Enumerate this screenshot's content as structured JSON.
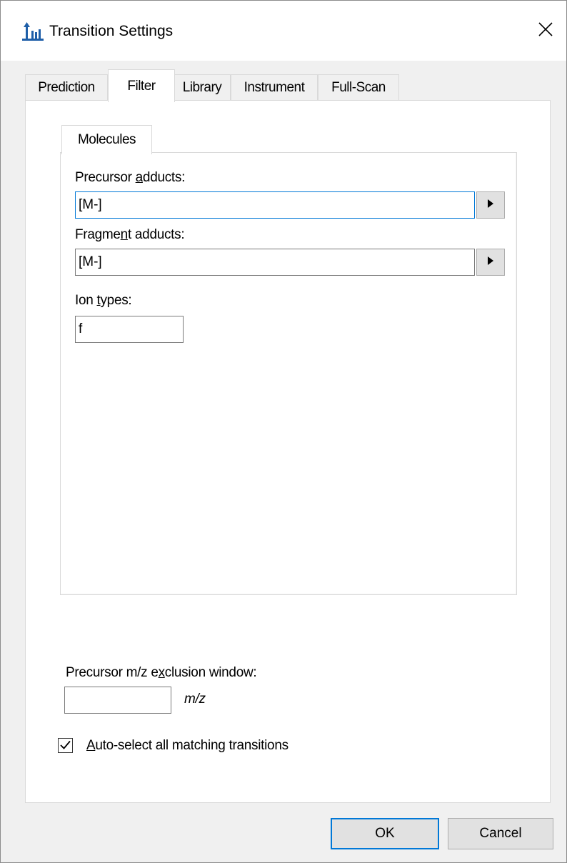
{
  "window": {
    "title": "Transition Settings"
  },
  "tabs": [
    {
      "label": "Prediction",
      "active": false
    },
    {
      "label": "Filter",
      "active": true
    },
    {
      "label": "Library",
      "active": false
    },
    {
      "label": "Instrument",
      "active": false
    },
    {
      "label": "Full-Scan",
      "active": false
    }
  ],
  "subtabs": [
    {
      "label": "Molecules",
      "active": true
    }
  ],
  "fields": {
    "precursor_adducts": {
      "label_before": "Precursor ",
      "label_mnemonic": "a",
      "label_after": "dducts:",
      "value": "[M-]"
    },
    "fragment_adducts": {
      "label_before": "Fragme",
      "label_mnemonic": "n",
      "label_after": "t adducts:",
      "value": "[M-]"
    },
    "ion_types": {
      "label_before": "Ion ",
      "label_mnemonic": "t",
      "label_after": "ypes:",
      "value": "f"
    },
    "exclusion_window": {
      "label_before": "Precursor m/z e",
      "label_mnemonic": "x",
      "label_after": "clusion window:",
      "value": "",
      "unit": "m/z"
    }
  },
  "auto_select": {
    "checked": true,
    "label_mnemonic": "A",
    "label_after": "uto-select all matching transitions"
  },
  "buttons": {
    "ok": "OK",
    "cancel": "Cancel"
  },
  "colors": {
    "focus_border": "#0078d7",
    "panel_background": "#ffffff",
    "dialog_background": "#f0f0f0"
  }
}
